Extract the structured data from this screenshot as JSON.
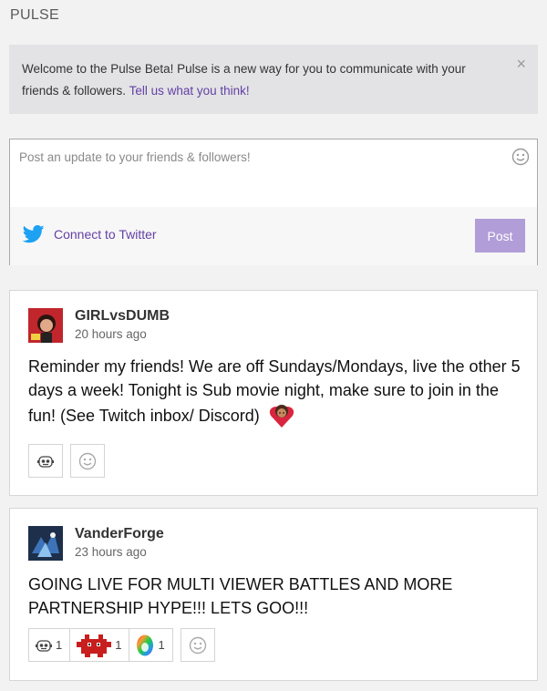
{
  "header": {
    "title": "PULSE"
  },
  "banner": {
    "text": "Welcome to the Pulse Beta! Pulse is a new way for you to communicate with your friends & followers.",
    "link": "Tell us what you think!",
    "close_icon": "×"
  },
  "composer": {
    "placeholder": "Post an update to your friends & followers!",
    "twitter_label": "Connect to Twitter",
    "post_label": "Post"
  },
  "posts": [
    {
      "author": "GIRLvsDUMB",
      "time": "20 hours ago",
      "body": "Reminder my friends! We are off Sundays/Mondays, live the other 5 days a week! Tonight is Sub movie night, make sure to join in the fun! (See Twitch inbox/ Discord)",
      "inline_emote": "heart-face-emote"
    },
    {
      "author": "VanderForge",
      "time": "23 hours ago",
      "body": "GOING LIVE FOR MULTI VIEWER BATTLES AND MORE PARTNERSHIP HYPE!!! LETS GOO!!!",
      "reactions": [
        {
          "icon": "robot-face-emote",
          "count": "1"
        },
        {
          "icon": "red-creature-emote",
          "count": "1"
        },
        {
          "icon": "rainbow-egg-emote",
          "count": "1"
        }
      ]
    }
  ],
  "colors": {
    "accent": "#6441a5",
    "post_button": "#b19dd8",
    "twitter": "#1da1f2"
  }
}
